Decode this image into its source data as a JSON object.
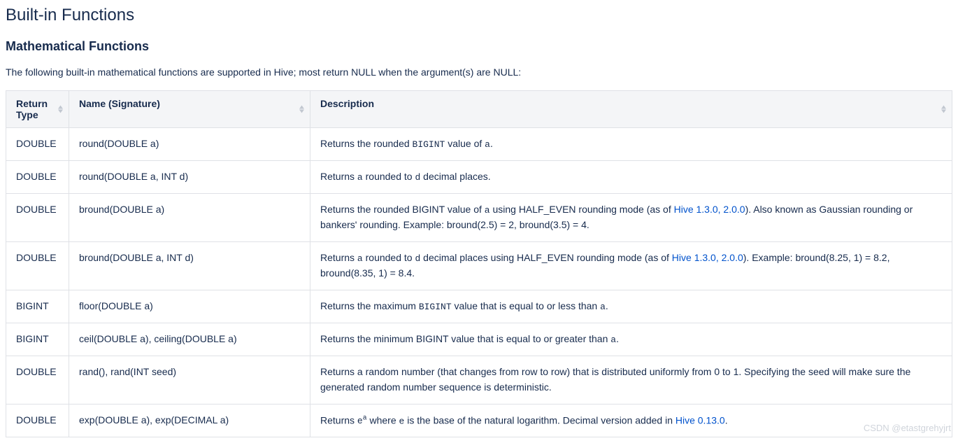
{
  "page": {
    "title": "Built-in Functions",
    "section_title": "Mathematical Functions",
    "intro": "The following built-in mathematical functions are supported in Hive; most return NULL when the argument(s) are NULL:"
  },
  "table": {
    "headers": {
      "return_type": "Return Type",
      "name": "Name (Signature)",
      "description": "Description"
    },
    "rows": [
      {
        "return_type": "DOUBLE",
        "signature": "round(DOUBLE a)",
        "description_html": "Returns the rounded <code>BIGINT</code> value of <code>a</code>."
      },
      {
        "return_type": "DOUBLE",
        "signature": "round(DOUBLE a, INT d)",
        "description_html": "Returns <code>a</code> rounded to <code>d</code> decimal places."
      },
      {
        "return_type": "DOUBLE",
        "signature": "bround(DOUBLE a)",
        "description_html": "Returns the rounded BIGINT value of <code>a</code> using HALF_EVEN rounding mode (as of <a href=\"#\">Hive 1.3.0, 2.0.0</a>). Also known as Gaussian rounding or bankers' rounding. Example: bround(2.5) = 2, bround(3.5) = 4."
      },
      {
        "return_type": "DOUBLE",
        "signature": "bround(DOUBLE a, INT d)",
        "description_html": "Returns <code>a</code> rounded to <code>d</code> decimal places using HALF_EVEN rounding mode (as of <a href=\"#\">Hive 1.3.0, 2.0.0</a>). Example: bround(8.25, 1) = 8.2, bround(8.35, 1) = 8.4."
      },
      {
        "return_type": "BIGINT",
        "signature": "floor(DOUBLE a)",
        "description_html": "Returns the maximum <code>BIGINT</code> value that is equal to or less than <code>a</code>."
      },
      {
        "return_type": "BIGINT",
        "signature": "ceil(DOUBLE a), ceiling(DOUBLE a)",
        "description_html": "Returns the minimum BIGINT value that is equal to or greater than <code>a</code>."
      },
      {
        "return_type": "DOUBLE",
        "signature": "rand(), rand(INT seed)",
        "description_html": "Returns a random number (that changes from row to row) that is distributed uniformly from 0 to 1. Specifying the seed will make sure the generated random number sequence is deterministic."
      },
      {
        "return_type": "DOUBLE",
        "signature": "exp(DOUBLE a), exp(DECIMAL a)",
        "description_html": "Returns <code>e<sup>a</sup></code> where <code>e</code> is the base of the natural logarithm. Decimal version added in <a href=\"#\">Hive 0.13.0</a>."
      }
    ]
  },
  "watermark": "CSDN @etastgrehyjrt"
}
